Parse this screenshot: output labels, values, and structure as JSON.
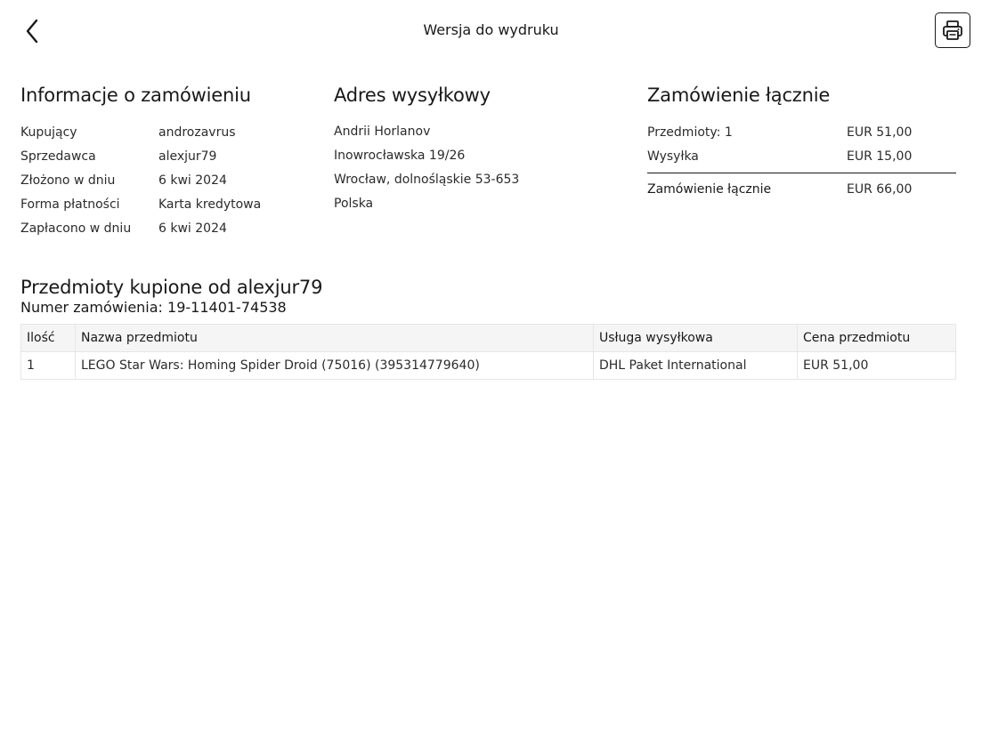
{
  "header": {
    "title": "Wersja do wydruku",
    "back_icon": "chevron-left-icon",
    "print_icon": "printer-icon"
  },
  "order_info": {
    "title": "Informacje o zamówieniu",
    "rows": [
      {
        "label": "Kupujący",
        "value": "androzavrus"
      },
      {
        "label": "Sprzedawca",
        "value": "alexjur79"
      },
      {
        "label": "Złożono w dniu",
        "value": "6 kwi 2024"
      },
      {
        "label": "Forma płatności",
        "value": "Karta kredytowa"
      },
      {
        "label": "Zapłacono w dniu",
        "value": "6 kwi 2024"
      }
    ]
  },
  "shipping_address": {
    "title": "Adres wysyłkowy",
    "lines": [
      "Andrii Horlanov",
      "Inowrocławska 19/26",
      "Wrocław, dolnośląskie 53-653",
      "Polska"
    ]
  },
  "order_total": {
    "title": "Zamówienie łącznie",
    "rows": [
      {
        "label": "Przedmioty: 1",
        "value": "EUR 51,00"
      },
      {
        "label": "Wysyłka",
        "value": "EUR 15,00"
      }
    ],
    "total": {
      "label": "Zamówienie łącznie",
      "value": "EUR 66,00"
    }
  },
  "items": {
    "title": "Przedmioty kupione od alexjur79",
    "order_number": "Numer zamówienia: 19-11401-74538",
    "columns": [
      "Ilość",
      "Nazwa przedmiotu",
      "Usługa wysyłkowa",
      "Cena przedmiotu"
    ],
    "rows": [
      {
        "qty": "1",
        "name": "LEGO Star Wars: Homing Spider Droid (75016) (395314779640)",
        "shipping": "DHL Paket International",
        "price": "EUR 51,00"
      }
    ]
  }
}
